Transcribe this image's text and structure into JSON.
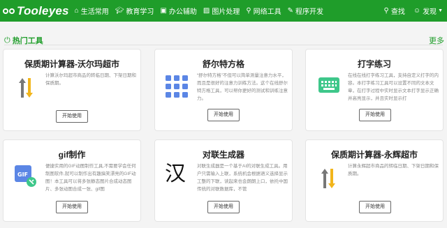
{
  "header": {
    "logo": "Tooleyes",
    "nav": [
      {
        "icon": "home-icon",
        "label": "生活常用"
      },
      {
        "icon": "graduation-cap-icon",
        "label": "教育学习"
      },
      {
        "icon": "briefcase-icon",
        "label": "办公辅助"
      },
      {
        "icon": "image-icon",
        "label": "图片处理"
      },
      {
        "icon": "network-icon",
        "label": "网络工具"
      },
      {
        "icon": "code-icon",
        "label": "程序开发"
      }
    ],
    "search_label": "查找",
    "discover_label": "发现"
  },
  "section": {
    "title": "热门工具",
    "more": "更多"
  },
  "cards": [
    {
      "title": "保质期计算器-沃尔玛超市",
      "desc": "计算沃尔玛超市商品的转临日期、下架日期和保质期。",
      "button": "开始使用",
      "icon": "arrows-updown-icon"
    },
    {
      "title": "舒尔特方格",
      "desc": "“舒尔特方格”不但可以简单测量注意力水平，而且是很好的注意力训练方法。这个在线舒尔特方格工具，可以帮你更好的测试和训练注意力。",
      "button": "开始使用",
      "icon": "grid-icon"
    },
    {
      "title": "打字练习",
      "desc": "在线在线打字练习工具，支持自定义打字的内容。本打字练习工具可以设置不同的文本文章，在打字过程中实时显示文本打字显示正确并高亮显示，并且实时显示打",
      "button": "开始使用",
      "icon": "keyboard-icon"
    },
    {
      "title": "gif制作",
      "desc": "便捷实用的GIF动图制作工具,不需要学会任何制图软件,就可以制作出有趣搞笑漂亮的GIF动图！本工具可以将多张静态图片合成动态图片、多张动图合成一张、gif图",
      "button": "开始使用",
      "icon": "gif-icon"
    },
    {
      "title": "对联生成器",
      "desc": "对联生成器是一个基于AI的对联生成工具。用户只需输入上联，系统机会根据语义选择显示工整的下联，读起来也会朗朗上口，依托中国传统的对联数据库，不管",
      "button": "开始使用",
      "icon": "han-character-icon",
      "glyph": "汉"
    },
    {
      "title": "保质期计算器-永辉超市",
      "desc": "计算永辉超市商品的转临日期、下架日期和保质期。",
      "button": "开始使用",
      "icon": "arrows-updown-icon"
    }
  ]
}
